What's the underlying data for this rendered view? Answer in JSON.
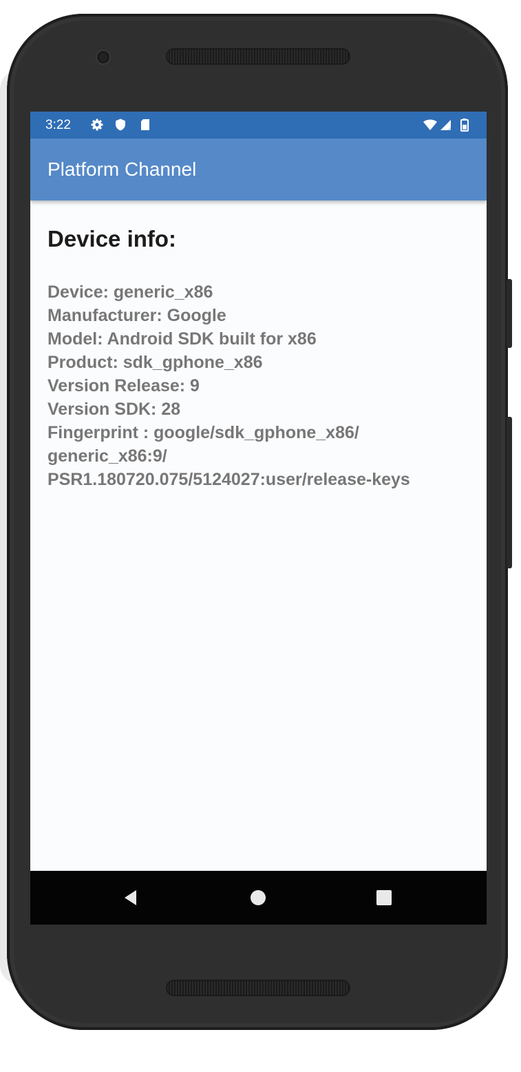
{
  "status_bar": {
    "time": "3:22",
    "icons": [
      "gear-icon",
      "shield-icon",
      "sd-card-icon",
      "wifi-icon",
      "signal-icon",
      "battery-icon"
    ],
    "background": "#2f6db5"
  },
  "app_bar": {
    "title": "Platform Channel",
    "background": "#5589c8"
  },
  "content": {
    "heading": "Device info:",
    "lines": [
      "Device: generic_x86",
      "Manufacturer: Google",
      "Model: Android SDK built for x86",
      "Product: sdk_gphone_x86",
      "Version Release: 9",
      "Version SDK: 28",
      "Fingerprint : google/sdk_gphone_x86/",
      "generic_x86:9/",
      "PSR1.180720.075/5124027:user/release-keys"
    ]
  },
  "nav_bar": {
    "buttons": [
      "back-icon",
      "home-icon",
      "recents-icon"
    ],
    "background": "#040404"
  }
}
